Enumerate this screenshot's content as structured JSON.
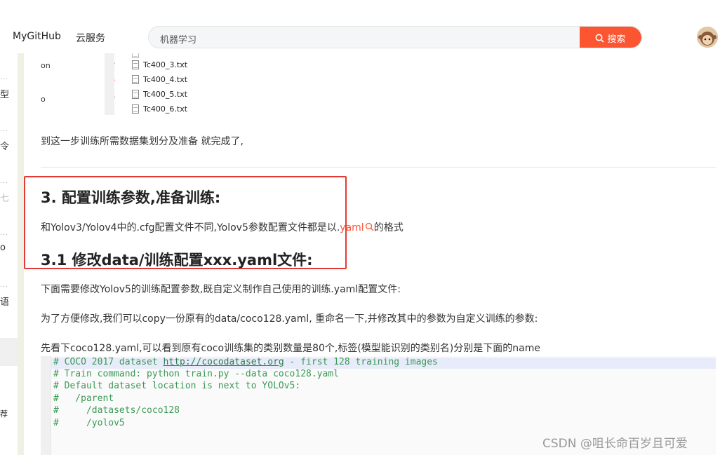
{
  "topbar": {
    "links": [
      "MyGitHub",
      "云服务"
    ],
    "search": {
      "value": "机器学习",
      "button_label": "搜索"
    }
  },
  "leftstrip": {
    "chars": [
      "型",
      "令",
      "七",
      "o",
      "语",
      "荐"
    ]
  },
  "explorer": {
    "pane_items": [
      "on",
      "o"
    ],
    "files": [
      "Tc400_3.txt",
      "Tc400_4.txt",
      "Tc400_5.txt",
      "Tc400_6.txt"
    ]
  },
  "article": {
    "p_done": "到这一步训练所需数据集划分及准备 就完成了,",
    "h3_section": "3. 配置训练参数,准备训练:",
    "p_yaml_before": "和Yolov3/Yolov4中的.cfg配置文件不同,Yolov5参数配置文件都是以.",
    "p_yaml_link": "yaml",
    "p_yaml_after": "的格式",
    "h3_sub": "3.1 修改data/训练配置xxx.yaml文件:",
    "p_modify": "下面需要修改Yolov5的训练配置参数,既自定义制作自己使用的训练.yaml配置文件:",
    "p_copy": "为了方便修改,我们可以copy一份原有的data/coco128.yaml, 重命名一下,并修改其中的参数为自定义训练的参数:",
    "p_look": "先看下coco128.yaml,可以看到原有coco训练集的类别数量是80个,标签(模型能识别的类别名)分别是下面的name"
  },
  "code": {
    "line1_pre": "# COCO 2017 dataset ",
    "line1_url": "http://cocodataset.org",
    "line1_post": " - first 128 training images",
    "line2": "# Train command: python train.py --data coco128.yaml",
    "line3": "# Default dataset location is next to YOLOv5:",
    "line4": "#   /parent",
    "line5": "#     /datasets/coco128",
    "line6": "#     /yolov5"
  },
  "watermark": "CSDN @咀长命百岁且可爱",
  "colors": {
    "accent": "#fc5531",
    "highlight_box": "#e53935",
    "code_comment": "#3c9a57"
  },
  "icons": [
    "search-icon",
    "pin-icon",
    "file-icon",
    "avatar"
  ]
}
